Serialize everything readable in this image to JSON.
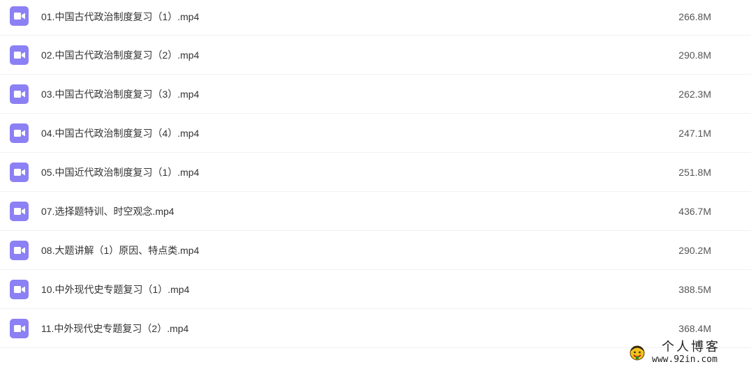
{
  "files": [
    {
      "name": "01.中国古代政治制度复习（1）.mp4",
      "size": "266.8M",
      "icon": "video-file-icon"
    },
    {
      "name": "02.中国古代政治制度复习（2）.mp4",
      "size": "290.8M",
      "icon": "video-file-icon"
    },
    {
      "name": "03.中国古代政治制度复习（3）.mp4",
      "size": "262.3M",
      "icon": "video-file-icon"
    },
    {
      "name": "04.中国古代政治制度复习（4）.mp4",
      "size": "247.1M",
      "icon": "video-file-icon"
    },
    {
      "name": "05.中国近代政治制度复习（1）.mp4",
      "size": "251.8M",
      "icon": "video-file-icon"
    },
    {
      "name": "07.选择题特训、时空观念.mp4",
      "size": "436.7M",
      "icon": "video-file-icon"
    },
    {
      "name": "08.大题讲解（1）原因、特点类.mp4",
      "size": "290.2M",
      "icon": "video-file-icon"
    },
    {
      "name": "10.中外现代史专题复习（1）.mp4",
      "size": "388.5M",
      "icon": "video-file-icon"
    },
    {
      "name": "11.中外现代史专题复习（2）.mp4",
      "size": "368.4M",
      "icon": "video-file-icon"
    }
  ],
  "watermark": {
    "title": "个人博客",
    "url": "www.92in.com"
  },
  "colors": {
    "icon_bg": "#8c80f5",
    "row_divider": "#eef0f3"
  }
}
